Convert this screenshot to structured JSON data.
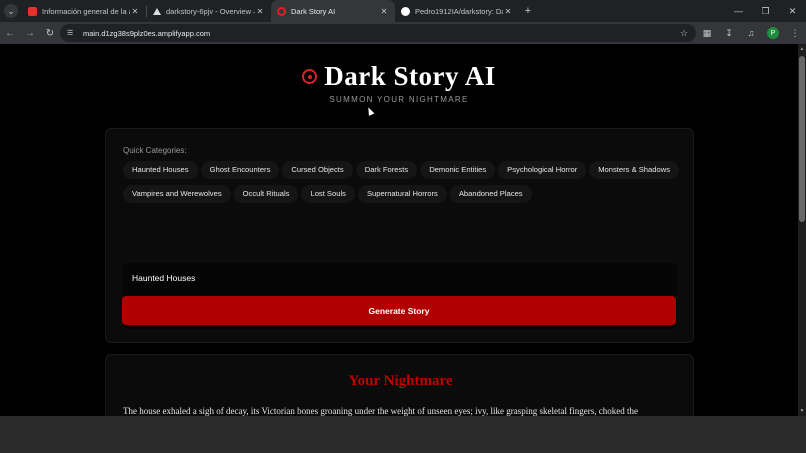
{
  "browser": {
    "tabs": [
      {
        "title": "Información general de la aplic",
        "favicon_color": "#e0342a",
        "active": false
      },
      {
        "title": "darkstory-6pjv - Overview – Ve",
        "favicon_color": "#dadce0",
        "active": false
      },
      {
        "title": "Dark Story AI",
        "favicon_color": "#e02020",
        "active": true
      },
      {
        "title": "Pedro1912IA/darkstory: DarkSt",
        "favicon_color": "#ffffff",
        "active": false
      }
    ],
    "new_tab_label": "+",
    "url": "main.d1zg38s9plz0es.amplifyapp.com",
    "profile_initial": "P"
  },
  "app": {
    "title": "Dark Story AI",
    "tagline": "SUMMON YOUR NIGHTMARE",
    "accent_color": "#b00000",
    "quick_categories_label": "Quick Categories:",
    "categories_row1": [
      "Haunted Houses",
      "Ghost Encounters",
      "Cursed Objects",
      "Dark Forests",
      "Demonic Entities",
      "Psychological Horror",
      "Monsters & Shadows"
    ],
    "categories_row2": [
      "Vampires and Werewolves",
      "Occult Rituals",
      "Lost Souls",
      "Supernatural Horrors",
      "Abandoned Places"
    ],
    "prompt_value": "Haunted Houses",
    "generate_label": "Generate Story",
    "result_title": "Your Nightmare",
    "result_text": "The house exhaled a sigh of decay, its Victorian bones groaning under the weight of unseen eyes; ivy, like grasping skeletal fingers, choked the"
  },
  "icons": {
    "tab_search": "chevron-down-icon",
    "back": "arrow-left-icon",
    "forward": "arrow-right-icon",
    "reload": "reload-icon",
    "site_settings": "tune-icon",
    "bookmark": "star-icon",
    "extensions": "puzzle-icon",
    "downloads": "download-icon",
    "media": "media-control-icon"
  }
}
